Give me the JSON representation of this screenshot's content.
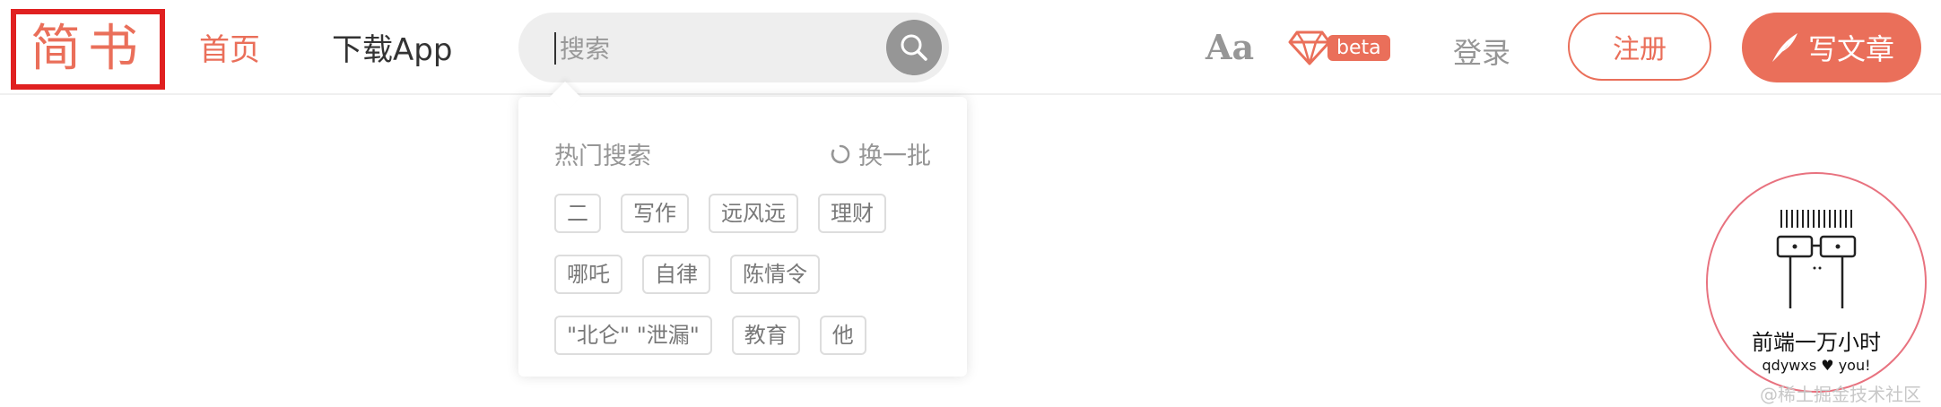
{
  "header": {
    "logo": "简书",
    "nav_home": "首页",
    "nav_download": "下载App",
    "search_placeholder": "搜索",
    "aa_label": "Aa",
    "beta_label": "beta",
    "login_label": "登录",
    "register_label": "注册",
    "write_label": "写文章"
  },
  "hot_search": {
    "title": "热门搜索",
    "refresh_label": "换一批",
    "rows": [
      [
        "二",
        "写作",
        "远风远",
        "理财"
      ],
      [
        "哪吒",
        "自律",
        "陈情令"
      ],
      [
        "\"北仑\" \"泄漏\"",
        "教育",
        "他"
      ]
    ]
  },
  "avatar": {
    "name": "前端一万小时",
    "subtitle": "qdywxs ♥ you!"
  },
  "watermark": "@稀土掘金技术社区",
  "colors": {
    "accent": "#ea6f5a",
    "search_bg": "#eeeeee",
    "muted": "#969696"
  },
  "icons": [
    "search-icon",
    "font-size-icon",
    "diamond-icon",
    "feather-pen-icon",
    "refresh-icon"
  ]
}
